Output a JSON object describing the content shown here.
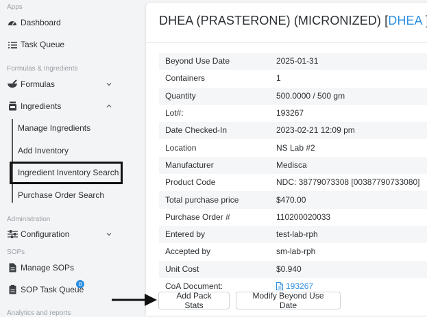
{
  "sidebar": {
    "sections": {
      "apps": "Apps",
      "formulas_ingredients": "Formulas & Ingredients",
      "administration": "Administration",
      "sops": "SOPs",
      "analytics": "Analytics and reports"
    },
    "items": {
      "dashboard": "Dashboard",
      "task_queue": "Task Queue",
      "formulas": "Formulas",
      "ingredients": "Ingredients",
      "configuration": "Configuration",
      "manage_sops": "Manage SOPs",
      "sop_task_queue": "SOP Task Queue",
      "sop_task_queue_badge": "0"
    },
    "ingredients_sub": {
      "manage": "Manage Ingredients",
      "add_inventory": "Add Inventory",
      "inventory_search": "Ingredient Inventory Search",
      "purchase_order_search": "Purchase Order Search"
    }
  },
  "main": {
    "title": "DHEA (PRASTERONE) (MICRONIZED) [",
    "title_link": "DHEA",
    "title_end": " ]",
    "details": [
      {
        "label": "Beyond Use Date",
        "value": "2025-01-31"
      },
      {
        "label": "Containers",
        "value": "1"
      },
      {
        "label": "Quantity",
        "value": "500.0000 / 500 gm"
      },
      {
        "label": "Lot#:",
        "value": "193267"
      },
      {
        "label": "Date Checked-In",
        "value": "2023-02-21 12:09 pm"
      },
      {
        "label": "Location",
        "value": "NS Lab #2"
      },
      {
        "label": "Manufacturer",
        "value": "Medisca"
      },
      {
        "label": "Product Code",
        "value": "NDC: 38779073308 [00387790733080]"
      },
      {
        "label": "Total purchase price",
        "value": "$470.00"
      },
      {
        "label": "Purchase Order #",
        "value": "110200020033"
      },
      {
        "label": "Entered by",
        "value": "test-lab-rph"
      },
      {
        "label": "Accepted by",
        "value": "sm-lab-rph"
      },
      {
        "label": "Unit Cost",
        "value": "$0.940"
      },
      {
        "label": "CoA Document:",
        "value": "193267"
      }
    ],
    "buttons": {
      "add_pack_stats": "Add Pack Stats",
      "modify_bud": "Modify Beyond Use Date"
    }
  },
  "colors": {
    "accent": "#2f8fe0",
    "sidebar_bg": "#f3f4f6",
    "row_stripe": "#f5f6f7"
  }
}
